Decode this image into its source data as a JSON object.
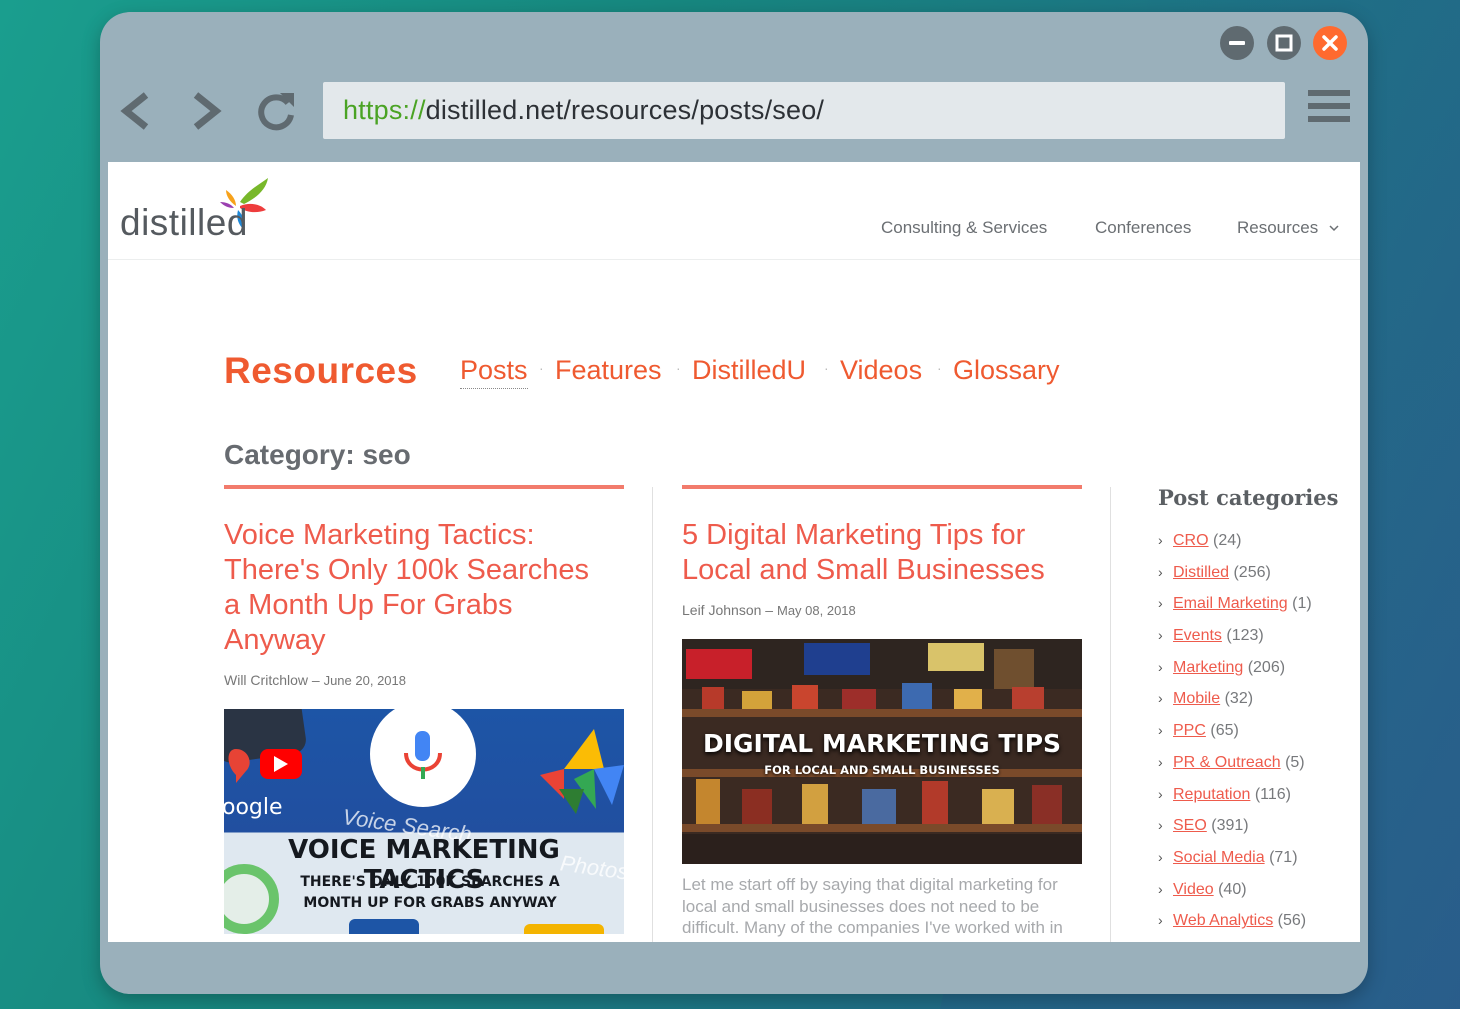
{
  "browser": {
    "url_scheme": "https://",
    "url_rest": "distilled.net/resources/posts/seo/"
  },
  "site": {
    "logo_text": "distilled",
    "nav": [
      "Consulting & Services",
      "Conferences",
      "Resources"
    ]
  },
  "resources": {
    "title": "Resources",
    "tabs": [
      "Posts",
      "Features",
      "DistilledU",
      "Videos",
      "Glossary"
    ],
    "category": "Category: seo"
  },
  "posts": [
    {
      "title_lines": [
        "Voice Marketing Tactics:",
        "There's Only 100k Searches",
        "a Month Up For Grabs",
        "Anyway"
      ],
      "author": "Will Critchlow",
      "date": "June 20, 2018",
      "image_headline": "VOICE MARKETING TACTICS",
      "image_sub1": "THERE'S ONLY 100K SEARCHES A",
      "image_sub2": "MONTH UP FOR GRABS ANYWAY",
      "image_fragment_google": "oogle",
      "image_fragment_voice": "Voice Search",
      "image_fragment_photos": "Photos"
    },
    {
      "title_lines": [
        "5 Digital Marketing Tips for",
        "Local and Small Businesses"
      ],
      "author": "Leif Johnson",
      "date": "May 08, 2018",
      "image_headline": "DIGITAL MARKETING TIPS",
      "image_sub": "FOR LOCAL AND SMALL BUSINESSES",
      "excerpt_lines": [
        "Let me start off by saying that digital marketing for",
        "local and small businesses does not need to be",
        "difficult. Many of the companies I've worked with in"
      ]
    }
  ],
  "sidebar": {
    "title": "Post categories",
    "categories": [
      {
        "name": "CRO",
        "count": "(24)"
      },
      {
        "name": "Distilled",
        "count": "(256)"
      },
      {
        "name": "Email Marketing",
        "count": "(1)"
      },
      {
        "name": "Events",
        "count": "(123)"
      },
      {
        "name": "Marketing",
        "count": "(206)"
      },
      {
        "name": "Mobile",
        "count": "(32)"
      },
      {
        "name": "PPC",
        "count": "(65)"
      },
      {
        "name": "PR & Outreach",
        "count": "(5)"
      },
      {
        "name": "Reputation",
        "count": "(116)"
      },
      {
        "name": "SEO",
        "count": "(391)"
      },
      {
        "name": "Social Media",
        "count": "(71)"
      },
      {
        "name": "Video",
        "count": "(40)"
      },
      {
        "name": "Web Analytics",
        "count": "(56)"
      }
    ]
  },
  "colors": {
    "accent": "#ef5a30",
    "link": "#ee5b4c",
    "rule": "#f27b6c",
    "close_button": "#ff6a2f",
    "url_scheme": "#4aa324"
  }
}
